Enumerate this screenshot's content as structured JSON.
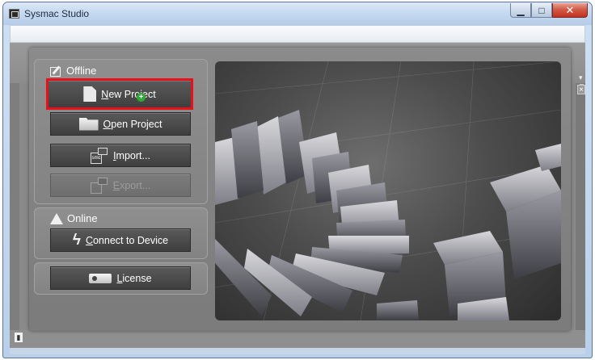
{
  "window": {
    "title": "Sysmac Studio",
    "icons": {
      "app": "sysmac-app-icon",
      "minimize": "minimize-icon",
      "maximize": "maximize-icon",
      "close": "close-icon"
    }
  },
  "workspace": {
    "pin_glyph": "▾ ⊓",
    "close_glyph": "×",
    "status_glyph": "▮"
  },
  "start_page": {
    "offline": {
      "label": "Offline",
      "icon": "pen-paper-icon",
      "buttons": [
        {
          "id": "new_project",
          "label": "New Project",
          "icon": "new-document-icon",
          "enabled": true,
          "highlighted": true
        },
        {
          "id": "open_project",
          "label": "Open Project",
          "icon": "folder-icon",
          "enabled": true
        },
        {
          "id": "import",
          "label": "Import...",
          "icon": "smc-import-icon",
          "enabled": true
        },
        {
          "id": "export",
          "label": "Export...",
          "icon": "smc-export-icon",
          "enabled": false
        }
      ]
    },
    "online": {
      "label": "Online",
      "icon": "warning-icon",
      "buttons": [
        {
          "id": "connect",
          "label": "Connect to Device",
          "icon": "lightning-icon",
          "enabled": true
        }
      ]
    },
    "license": {
      "buttons": [
        {
          "id": "license",
          "label": "License",
          "icon": "key-icon",
          "enabled": true
        }
      ]
    },
    "preview_image": "spiral-blocks-3d-render",
    "highlight_color": "#e8101a"
  },
  "colors": {
    "dialog_bg": "#838383",
    "button_bg": "#4a4a4a",
    "button_text": "#ffffff",
    "disabled_text": "#9c9c9c",
    "title_bar": "#c7daf0",
    "close_button": "#c1331f"
  }
}
